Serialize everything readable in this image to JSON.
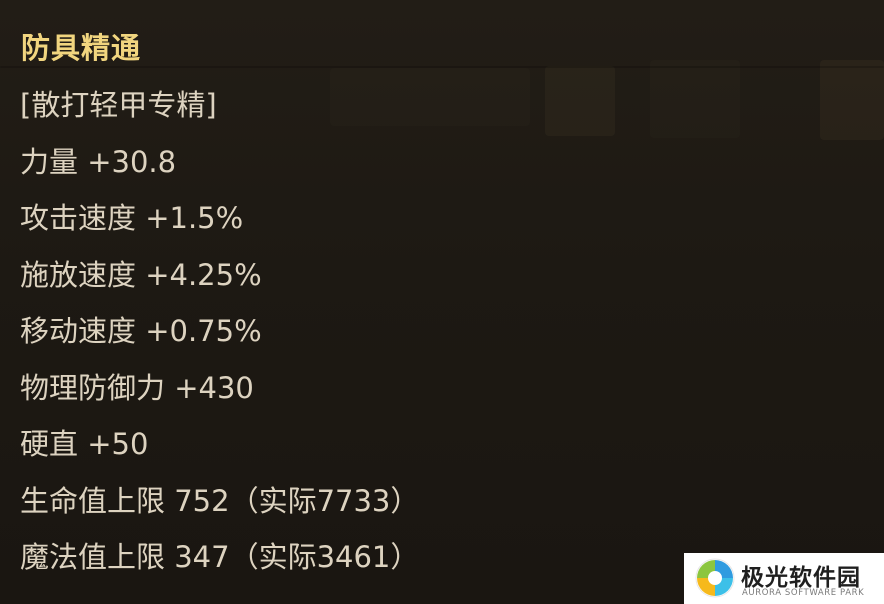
{
  "tooltip": {
    "title": "防具精通",
    "lines": [
      "[散打轻甲专精]",
      "力量 +30.8",
      "攻击速度 +1.5%",
      "施放速度 +4.25%",
      "移动速度 +0.75%",
      "物理防御力 +430",
      "硬直 +50",
      "生命值上限 752（实际7733）",
      "魔法值上限 347（实际3461）"
    ]
  },
  "watermark": {
    "name": "极光软件园",
    "subtitle": "AURORA SOFTWARE PARK",
    "icon": "aurora-logo-icon"
  },
  "colors": {
    "title": "#f1d57f",
    "text": "#ddd3c0",
    "background": "#1c1813"
  }
}
